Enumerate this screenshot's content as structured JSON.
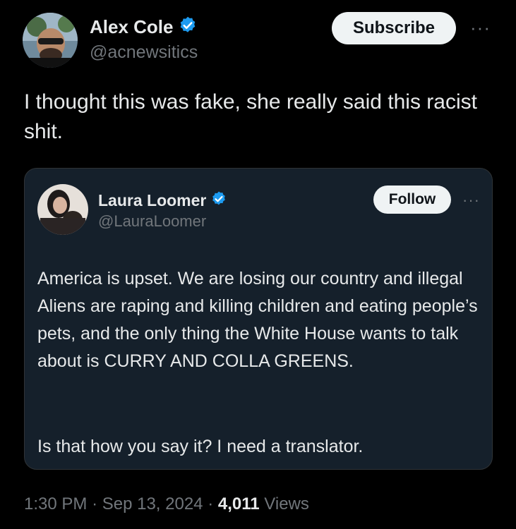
{
  "post": {
    "author_name": "Alex Cole",
    "author_handle": "@acnewsitics",
    "subscribe_label": "Subscribe",
    "text": "I thought this was fake, she really said this racist shit."
  },
  "quoted": {
    "author_name": "Laura Loomer",
    "author_handle": "@LauraLoomer",
    "follow_label": "Follow",
    "text_p1": "America is upset. We are losing our country and illegal Aliens are raping and killing children and eating people’s pets, and the only thing the White House wants to talk about is CURRY AND COLLA GREENS.",
    "text_p2": "Is that how you say it? I need a translator."
  },
  "meta": {
    "time": "1:30 PM",
    "separator": "·",
    "date": "Sep 13, 2024",
    "views_count": "4,011",
    "views_label": "Views"
  },
  "icons": {
    "verified": "verified-badge-icon",
    "more": "more-icon"
  },
  "colors": {
    "background": "#000000",
    "card": "#15202b",
    "verified": "#1d9bf0",
    "secondary_text": "#71767b",
    "button": "#eff3f4"
  }
}
